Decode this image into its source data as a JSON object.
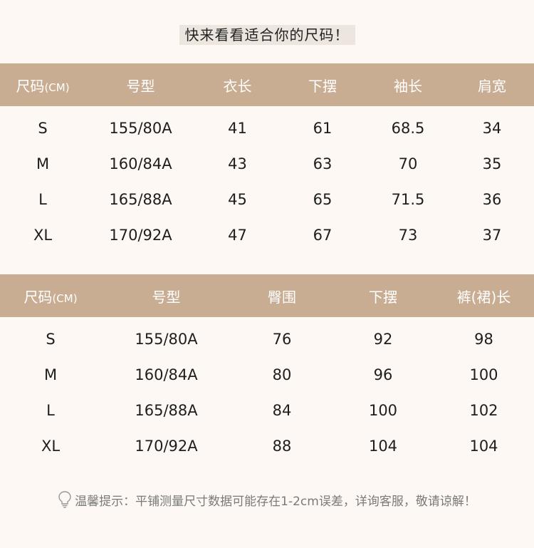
{
  "title": "快来看看适合你的尺码！",
  "table1": {
    "headers": [
      {
        "main": "尺码",
        "small": "(CM)"
      },
      {
        "main": "号型",
        "small": ""
      },
      {
        "main": "衣长",
        "small": ""
      },
      {
        "main": "下摆",
        "small": ""
      },
      {
        "main": "袖长",
        "small": ""
      },
      {
        "main": "肩宽",
        "small": ""
      }
    ],
    "rows": [
      [
        "S",
        "155/80A",
        "41",
        "61",
        "68.5",
        "34"
      ],
      [
        "M",
        "160/84A",
        "43",
        "63",
        "70",
        "35"
      ],
      [
        "L",
        "165/88A",
        "45",
        "65",
        "71.5",
        "36"
      ],
      [
        "XL",
        "170/92A",
        "47",
        "67",
        "73",
        "37"
      ]
    ]
  },
  "table2": {
    "headers": [
      {
        "main": "尺码",
        "small": "(CM)"
      },
      {
        "main": "号型",
        "small": ""
      },
      {
        "main": "臀围",
        "small": ""
      },
      {
        "main": "下摆",
        "small": ""
      },
      {
        "main": "裤(裙)长",
        "small": ""
      }
    ],
    "rows": [
      [
        "S",
        "155/80A",
        "76",
        "92",
        "98"
      ],
      [
        "M",
        "160/84A",
        "80",
        "96",
        "100"
      ],
      [
        "L",
        "165/88A",
        "84",
        "100",
        "102"
      ],
      [
        "XL",
        "170/92A",
        "88",
        "104",
        "104"
      ]
    ]
  },
  "footer": {
    "icon": "lightbulb-icon",
    "text": "温馨提示：平铺测量尺寸数据可能存在1-2cm误差，详询客服，敬请谅解！"
  },
  "colors": {
    "header_bg": "#c9ad93",
    "page_bg": "#fdf8f3",
    "title_bg": "#ece6df"
  }
}
